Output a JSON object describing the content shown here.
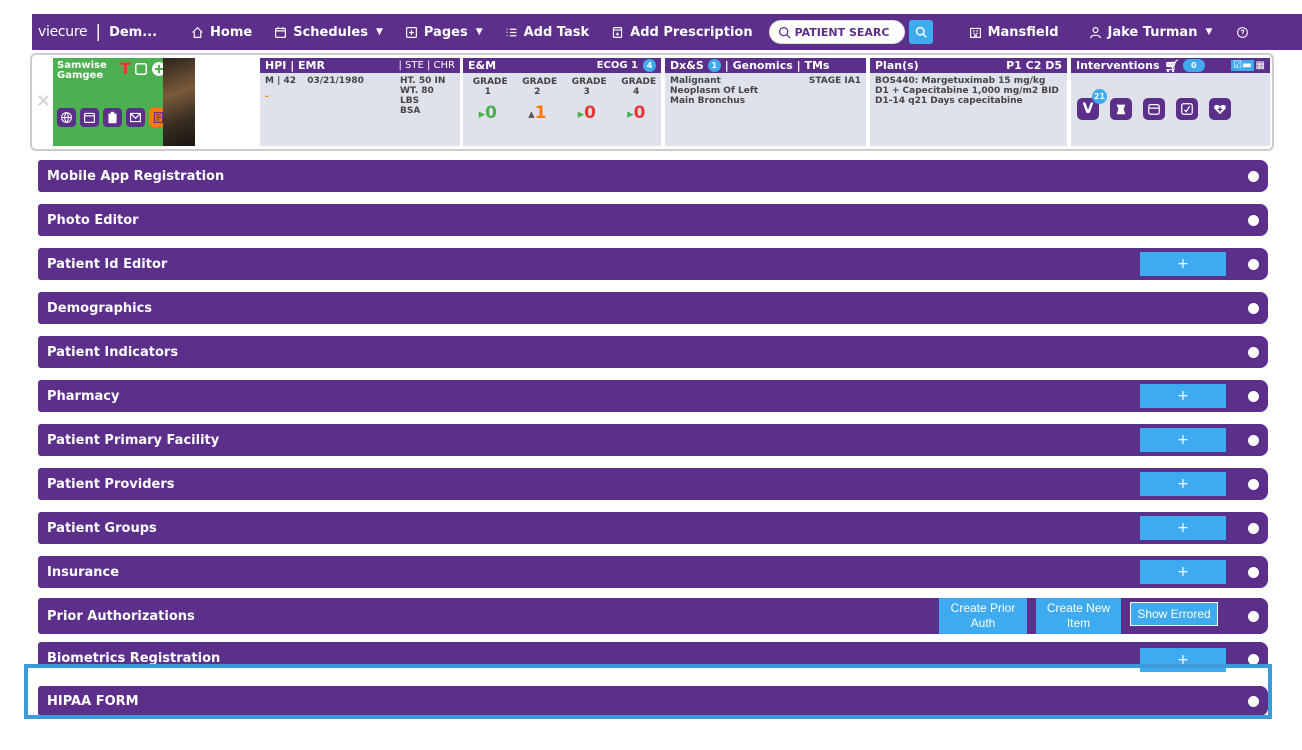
{
  "nav": {
    "logo": "viecure",
    "org": "Dem...",
    "home": "Home",
    "schedules": "Schedules",
    "pages": "Pages",
    "add_task": "Add Task",
    "add_prescription": "Add Prescription",
    "search_placeholder": "PATIENT SEARC",
    "location": "Mansfield",
    "user": "Jake Turman"
  },
  "patient": {
    "name": "Samwise Gamgee",
    "flag": "T"
  },
  "hpi": {
    "title": "HPI | EMR",
    "links": "| STE | CHR",
    "sex_age": "M | 42",
    "dob": "03/21/1980",
    "ht": "HT. 50 IN",
    "wt": "WT. 80 LBS",
    "bsa": "BSA",
    "dash": "-"
  },
  "em": {
    "title": "E&M",
    "ecog_label": "ECOG 1",
    "ecog_badge": "4",
    "grades": [
      "GRADE 1",
      "GRADE 2",
      "GRADE 3",
      "GRADE 4"
    ],
    "grade_values": [
      {
        "glyph": "▸",
        "value": "0",
        "color": "#4caf50"
      },
      {
        "glyph": "▴",
        "value": "1",
        "color": "#f57c00"
      },
      {
        "glyph": "▸",
        "value": "0",
        "color": "#e53935"
      },
      {
        "glyph": "▸",
        "value": "0",
        "color": "#e53935"
      }
    ]
  },
  "dx": {
    "title_a": "Dx&S",
    "badge": "1",
    "title_b": "| Genomics | TMs",
    "diagnosis": "Malignant Neoplasm Of Left Main Bronchus",
    "stage": "STAGE IA1"
  },
  "plan": {
    "title": "Plan(s)",
    "cycle": "P1 C2 D5",
    "text": "BOS440: Margetuximab 15 mg/kg D1 + Capecitabine 1,000 mg/m2 BID D1-14 q21 Days capecitabine"
  },
  "interventions": {
    "title": "Interventions",
    "cart_count": "0",
    "v_label": "V",
    "v_badge": "21"
  },
  "sections": [
    {
      "title": "Mobile App Registration",
      "plus": false
    },
    {
      "title": "Photo Editor",
      "plus": false
    },
    {
      "title": "Patient Id Editor",
      "plus": true
    },
    {
      "title": "Demographics",
      "plus": false
    },
    {
      "title": "Patient Indicators",
      "plus": false
    },
    {
      "title": "Pharmacy",
      "plus": true
    },
    {
      "title": "Patient Primary Facility",
      "plus": true
    },
    {
      "title": "Patient Providers",
      "plus": true
    },
    {
      "title": "Patient Groups",
      "plus": true
    },
    {
      "title": "Insurance",
      "plus": true
    },
    {
      "title": "Prior Authorizations",
      "plus": false
    },
    {
      "title": "Biometrics Registration",
      "plus": true
    },
    {
      "title": "HIPAA FORM",
      "plus": false
    }
  ],
  "plus_label": "+",
  "prior_auth": {
    "create_prior_auth": "Create Prior Auth",
    "create_new_item": "Create New Item",
    "show_errored": "Show Errored"
  },
  "colors": {
    "brand_purple": "#5c2f8a",
    "accent_blue": "#3eaaf0",
    "patient_green": "#4caf50",
    "highlight": "#3c9ad8"
  }
}
